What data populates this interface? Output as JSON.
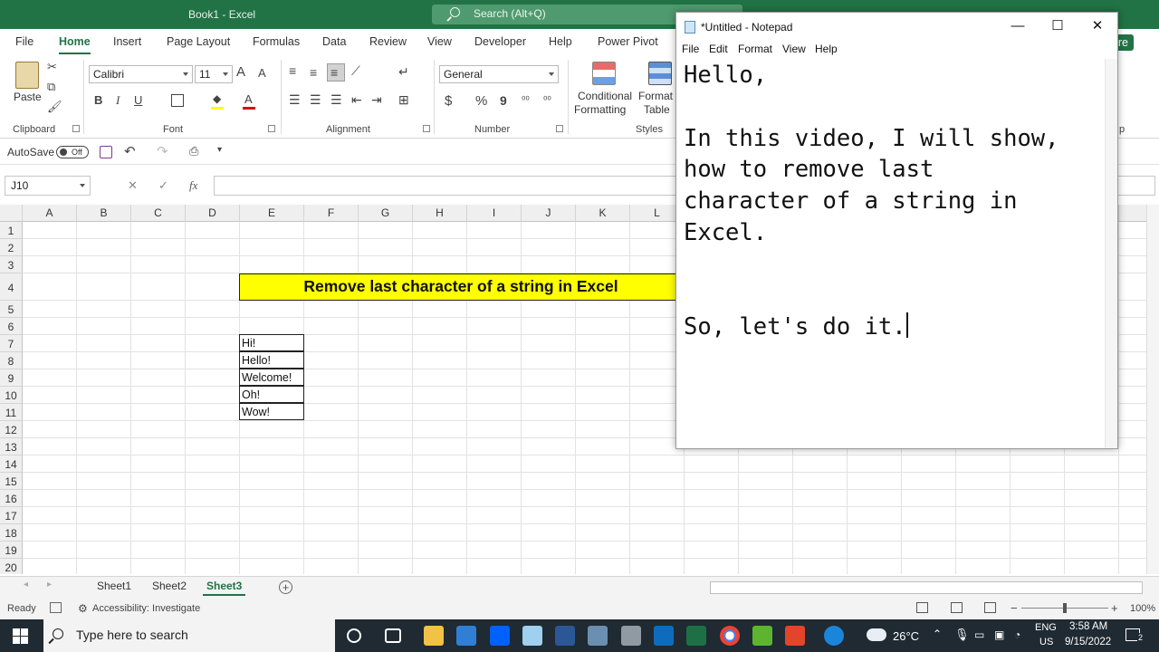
{
  "excel": {
    "title": "Book1  -  Excel",
    "search_placeholder": "Search (Alt+Q)",
    "tabs": [
      "File",
      "Home",
      "Insert",
      "Page Layout",
      "Formulas",
      "Data",
      "Review",
      "View",
      "Developer",
      "Help",
      "Power Pivot"
    ],
    "active_tab": "Home",
    "share_partial": "hare",
    "ribbon": {
      "paste_label": "Paste",
      "clipboard_label": "Clipboard",
      "font_name": "Calibri",
      "font_size": "11",
      "font_label": "Font",
      "alignment_label": "Alignment",
      "number_format": "General",
      "number_label": "Number",
      "conditional_formatting_line1": "Conditional",
      "conditional_formatting_line2": "Formatting",
      "format_as_table_line1": "Format a",
      "format_as_table_line2": "Table",
      "styles_label": "Styles",
      "bold": "B",
      "italic": "I",
      "underline": "U",
      "grow_font": "A",
      "shrink_font": "A",
      "currency": "$",
      "percent": "%",
      "comma": "9",
      "partial_group_label": "p"
    },
    "qat": {
      "autosave_label": "AutoSave",
      "autosave_state": "Off"
    },
    "formula_bar": {
      "name_box": "J10",
      "fx": "fx",
      "cancel": "✕",
      "enter": "✓"
    },
    "columns": [
      "A",
      "B",
      "C",
      "D",
      "E",
      "F",
      "G",
      "H",
      "I",
      "J",
      "K",
      "L"
    ],
    "rows": [
      "1",
      "2",
      "3",
      "4",
      "5",
      "6",
      "7",
      "8",
      "9",
      "10",
      "11",
      "12",
      "13",
      "14",
      "15",
      "16",
      "17",
      "18",
      "19",
      "20"
    ],
    "title_cell": "Remove last character of a string in Excel",
    "data_cells": [
      "Hi!",
      "Hello!",
      "Welcome!",
      "Oh!",
      "Wow!"
    ],
    "sheets": [
      "Sheet1",
      "Sheet2",
      "Sheet3"
    ],
    "active_sheet": "Sheet3",
    "status": {
      "ready": "Ready",
      "accessibility": "Accessibility: Investigate",
      "zoom": "100%",
      "minus": "−",
      "plus": "+"
    }
  },
  "notepad": {
    "title": "*Untitled - Notepad",
    "menu": [
      "File",
      "Edit",
      "Format",
      "View",
      "Help"
    ],
    "content": "Hello,\n\nIn this video, I will show,\nhow to remove last\ncharacter of a string in\nExcel.\n\n\nSo, let's do it."
  },
  "taskbar": {
    "search_placeholder": "Type here to search",
    "temperature": "26°C",
    "language_line1": "ENG",
    "language_line2": "US",
    "time": "3:58 AM",
    "date": "9/15/2022",
    "notification_count": "2"
  },
  "colors": {
    "excel_green": "#217346",
    "title_highlight": "#ffff00",
    "taskbar": "#1f2a33"
  }
}
